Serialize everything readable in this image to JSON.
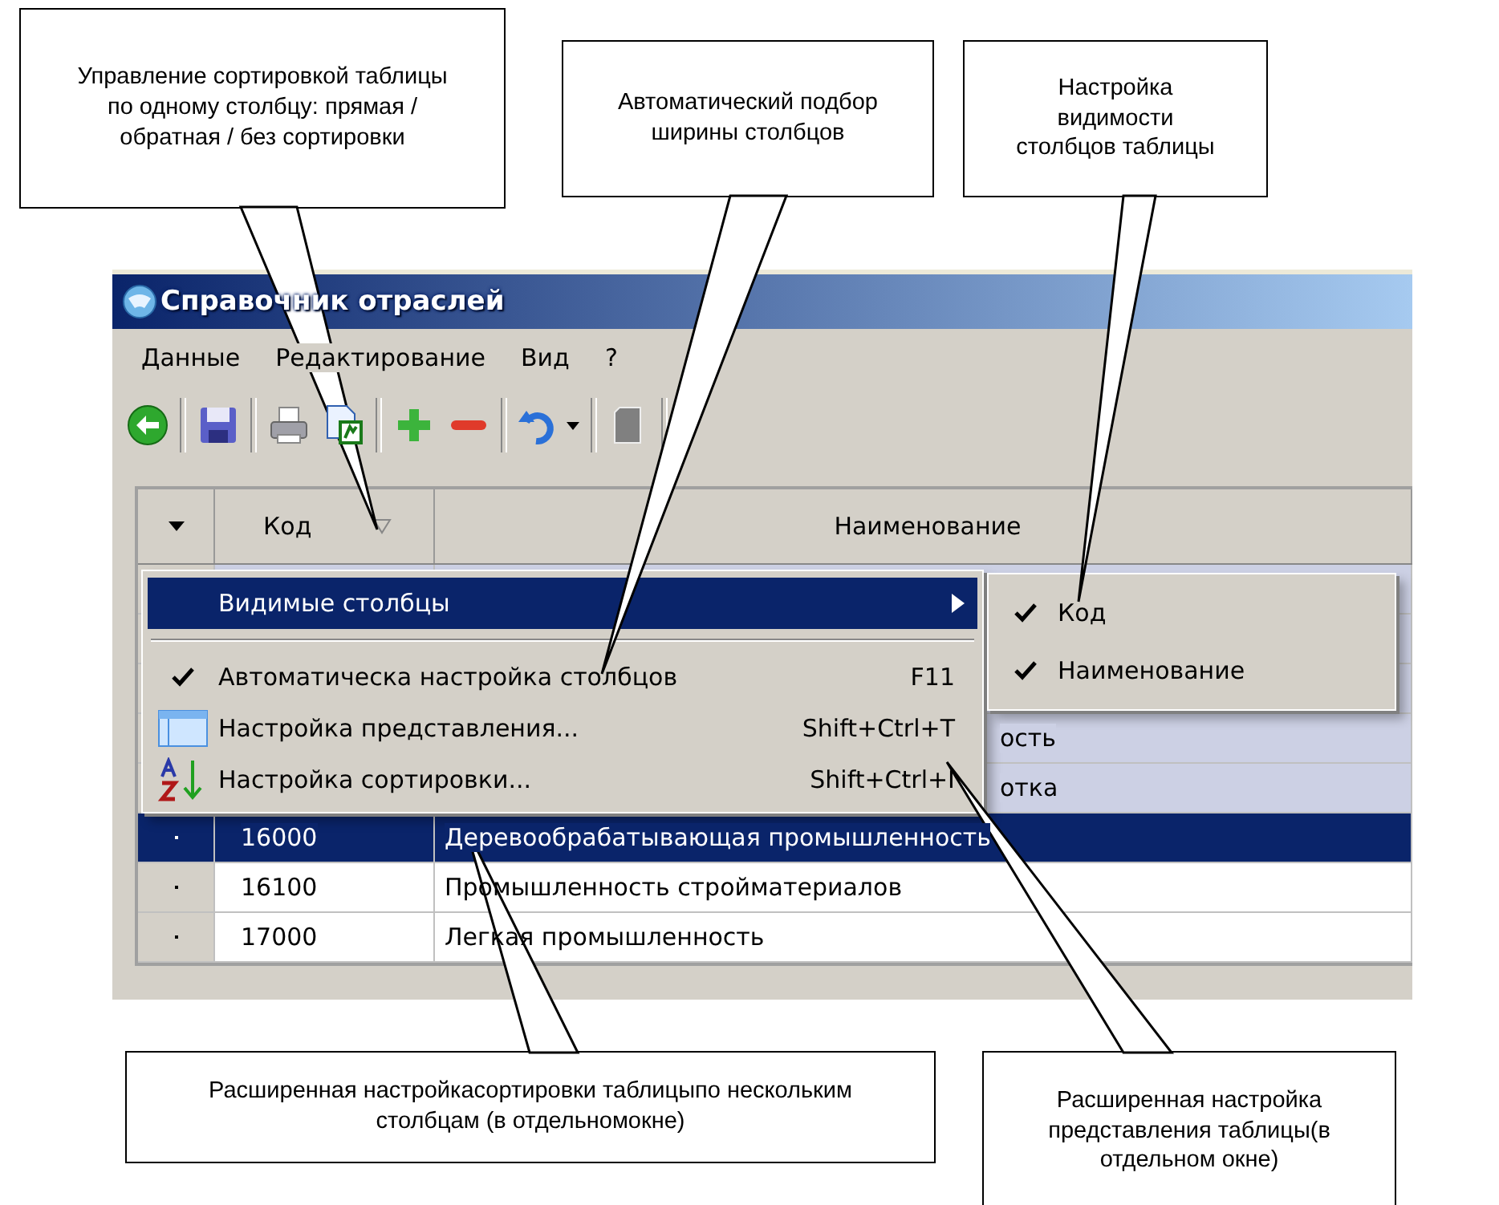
{
  "window": {
    "title": "Справочник отраслей"
  },
  "menu_bar": [
    "Данные",
    "Редактирование",
    "Вид",
    "?"
  ],
  "toolbar": [
    {
      "kind": "back"
    },
    {
      "kind": "separator"
    },
    {
      "kind": "save"
    },
    {
      "kind": "separator"
    },
    {
      "kind": "print"
    },
    {
      "kind": "export"
    },
    {
      "kind": "separator"
    },
    {
      "kind": "add"
    },
    {
      "kind": "remove"
    },
    {
      "kind": "separator"
    },
    {
      "kind": "undo"
    },
    {
      "kind": "dropdown"
    },
    {
      "kind": "separator"
    },
    {
      "kind": "page"
    },
    {
      "kind": "separator"
    }
  ],
  "table": {
    "columns": [
      "Код",
      "Наименование"
    ],
    "rows": [
      {
        "code": "",
        "name": "",
        "selected": false,
        "highlighted": true
      },
      {
        "code": "",
        "name": "",
        "selected": false,
        "highlighted": true
      },
      {
        "code": "",
        "name": "",
        "selected": false,
        "highlighted": true
      },
      {
        "code": "",
        "name": "ость",
        "kind": "partial",
        "selected": false,
        "highlighted": true
      },
      {
        "code": "",
        "name": "отка",
        "kind": "partial",
        "selected": false,
        "highlighted": true
      },
      {
        "code": "16000",
        "name": "Деревообрабатывающая промышленность",
        "selected": true,
        "highlighted": false
      },
      {
        "code": "16100",
        "name": "Промышленность стройматериалов",
        "selected": false,
        "highlighted": false
      },
      {
        "code": "17000",
        "name": "Легкая промышленность",
        "selected": false,
        "highlighted": false
      }
    ]
  },
  "context_menu": {
    "items": [
      {
        "kind": "submenu",
        "label": "Видимые столбцы",
        "selected": true
      },
      {
        "kind": "separator"
      },
      {
        "kind": "check",
        "label": "Автоматическа настройка столбцов",
        "shortcut": "F11",
        "checked": true,
        "selected": false
      },
      {
        "kind": "view",
        "label": "Настройка представления...",
        "shortcut": "Shift+Ctrl+T",
        "selected": false
      },
      {
        "kind": "sort",
        "label": "Настройка сортировки...",
        "shortcut": "Shift+Ctrl+I",
        "selected": false
      }
    ]
  },
  "submenu": {
    "items": [
      {
        "label": "Код",
        "checked": true
      },
      {
        "label": "Наименование",
        "checked": true
      }
    ]
  },
  "callouts": [
    {
      "text": "Управление сортировкой таблицы по одному столбцу: прямая / обратная / без сортировки"
    },
    {
      "text": "Автоматический подбор ширины столбцов"
    },
    {
      "text": "Настройка видимости столбцов таблицы"
    },
    {
      "text": "Расширенная настройкасортировки таблицыпо нескольким столбцам  (в отдельномокне)"
    },
    {
      "text": "Расширенная настройка представления таблицы(в отдельном окне)"
    }
  ]
}
